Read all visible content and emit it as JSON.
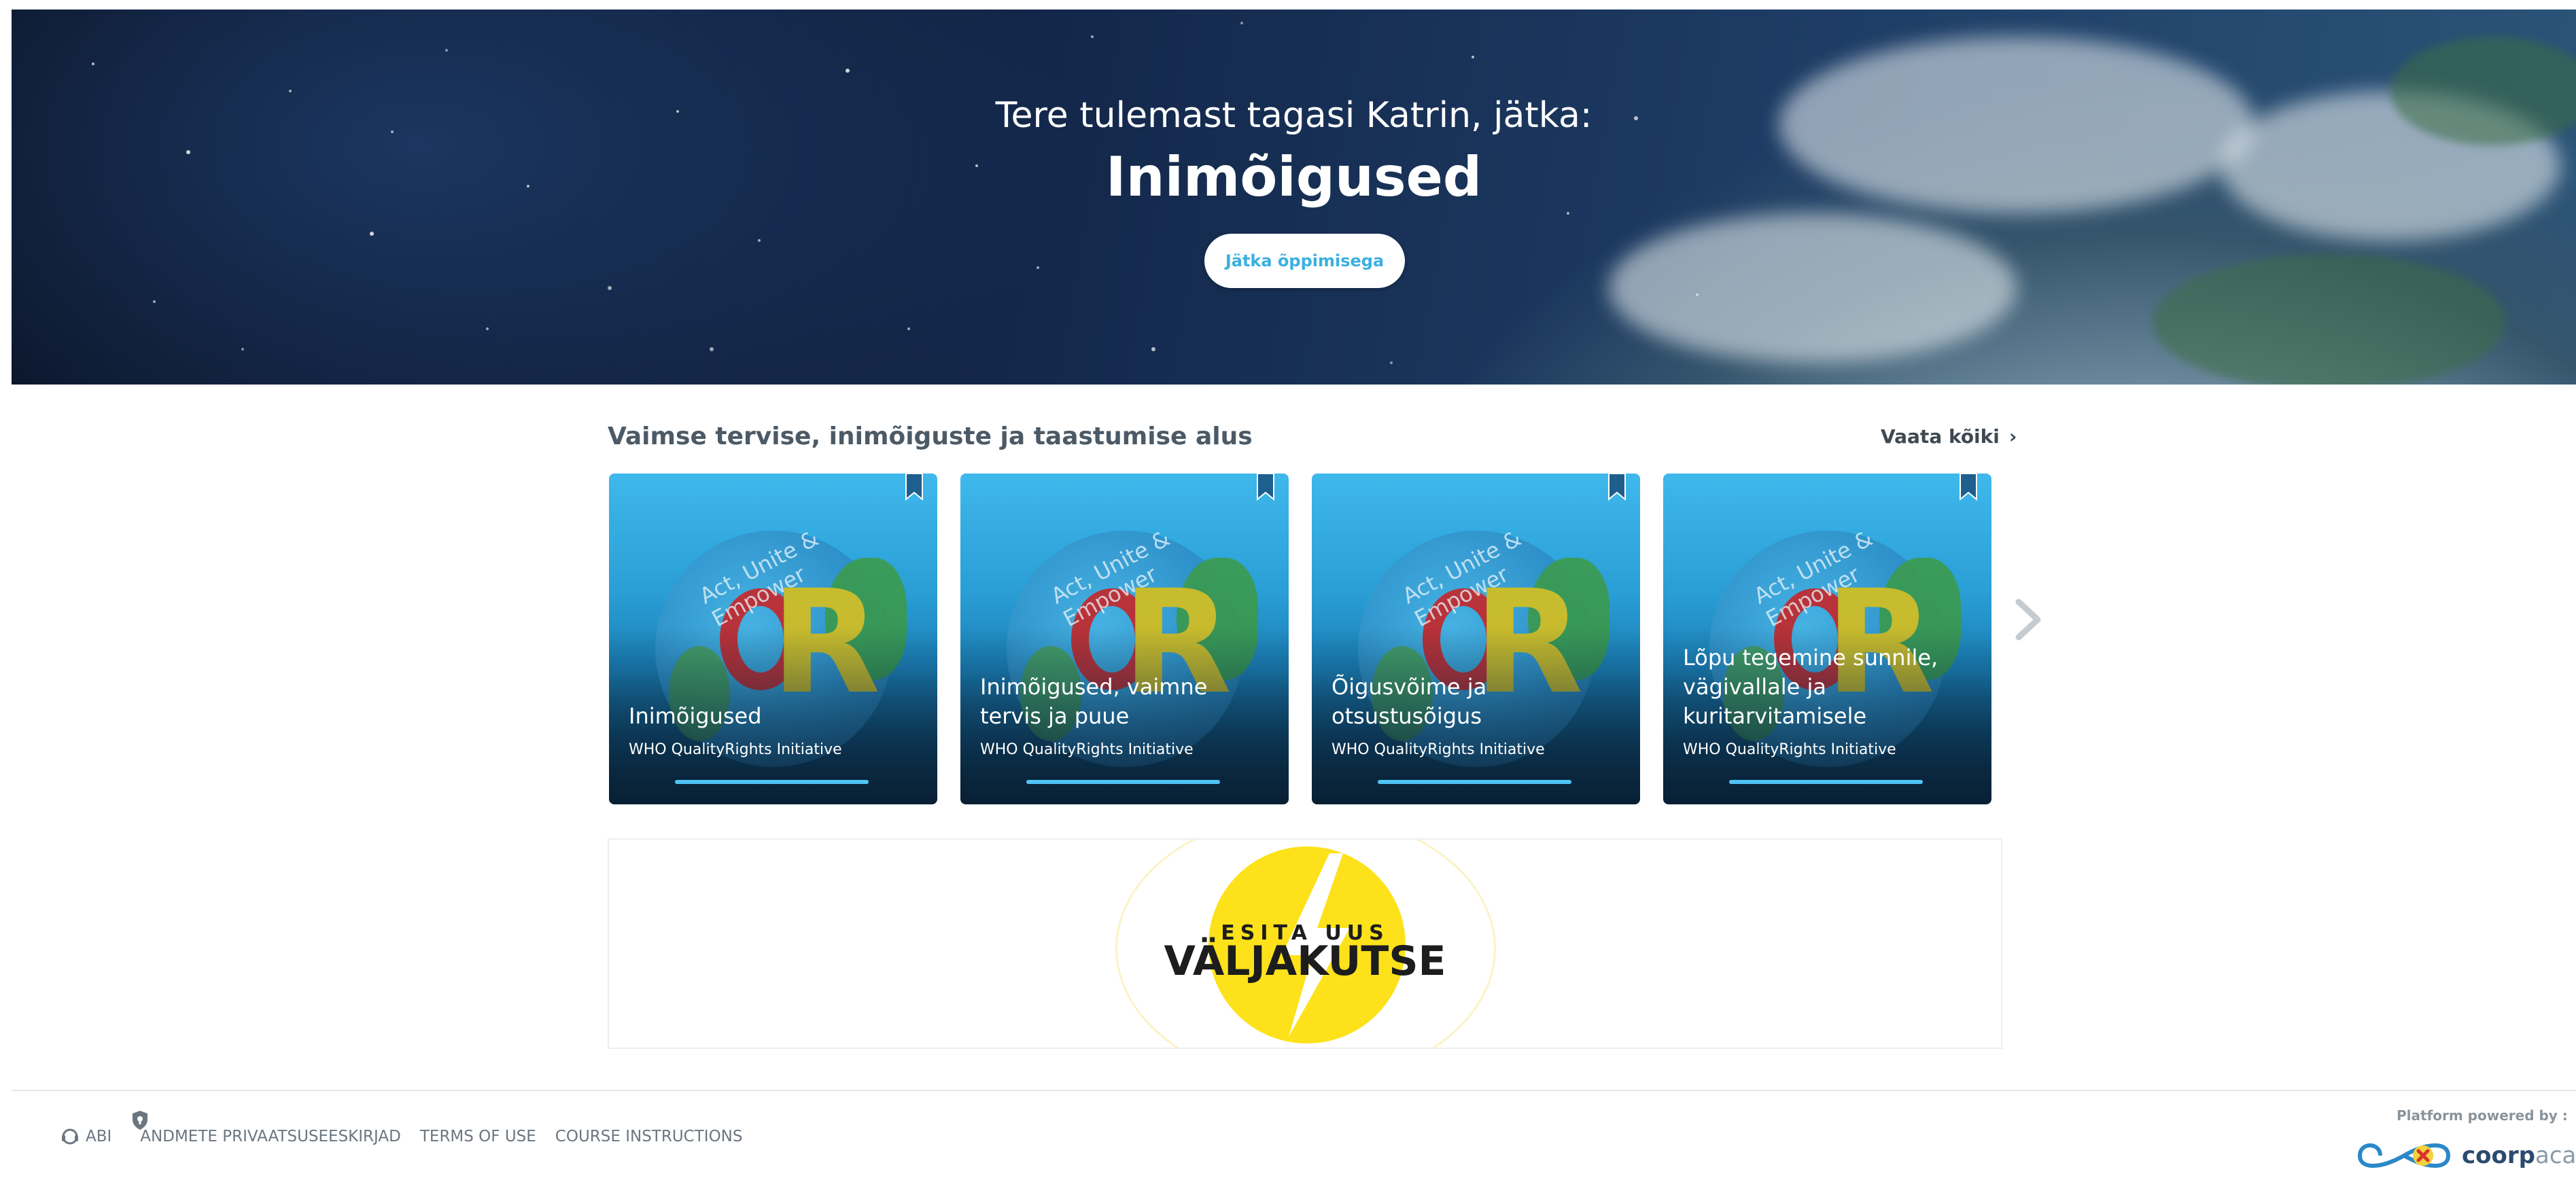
{
  "hero": {
    "welcome": "Tere tulemast tagasi Katrin, jätka:",
    "course_title": "Inimõigused",
    "continue_button": "Jätka õppimisega"
  },
  "section": {
    "title": "Vaimse tervise, inimõiguste ja taastumise alus",
    "see_all": "Vaata kõiki",
    "cards": [
      {
        "title": "Inimõigused",
        "author": "WHO QualityRights Initiative",
        "progress": 1.0,
        "logo_arc": "Act, Unite & Empower"
      },
      {
        "title": "Inimõigused, vaimne tervis ja puue",
        "author": "WHO QualityRights Initiative",
        "progress": 1.0,
        "logo_arc": "Act, Unite & Empower"
      },
      {
        "title": "Õigusvõime ja otsustusõigus",
        "author": "WHO QualityRights Initiative",
        "progress": 1.0,
        "logo_arc": "Act, Unite & Empower"
      },
      {
        "title": "Lõpu tegemine sunnile, vägivallale ja kuritarvitamisele",
        "author": "WHO QualityRights Initiative",
        "progress": 1.0,
        "logo_arc": "Act, Unite & Empower"
      }
    ]
  },
  "battle": {
    "small": "ESITA UUS",
    "big": "VÄLJAKUTSE"
  },
  "footer": {
    "help": "ABI",
    "privacy": "ANDMETE PRIVAATSUSEESKIRJAD",
    "terms": "TERMS OF USE",
    "instructions": "COURSE INSTRUCTIONS",
    "powered_by": "Platform powered by :",
    "brand_bold": "coorp",
    "brand_light": "academ"
  },
  "colors": {
    "accent": "#3ab0e0",
    "progress": "#4fc4f6",
    "battle_yellow": "#fde21b"
  }
}
